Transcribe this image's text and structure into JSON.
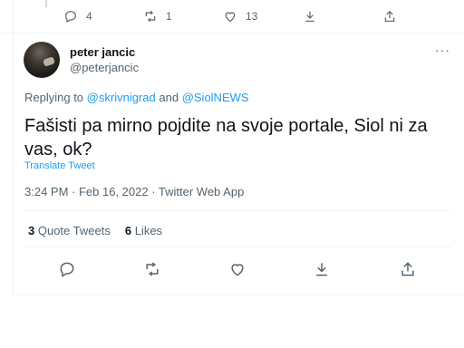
{
  "previous_tweet": {
    "reply_count": "4",
    "retweet_count": "1",
    "like_count": "13"
  },
  "tweet": {
    "author_name": "peter jancic",
    "author_handle": "@peterjancic",
    "more_label": "···",
    "replying_prefix": "Replying to",
    "replying_to_1": "@skrivnigrad",
    "replying_and": "and",
    "replying_to_2": "@SiolNEWS",
    "text": "Fašisti pa mirno pojdite na svoje portale, Siol ni za vas, ok?",
    "translate_label": "Translate Tweet",
    "timestamp": "3:24 PM · Feb 16, 2022 · Twitter Web App",
    "quote_tweets_count": "3",
    "quote_tweets_label": "Quote Tweets",
    "likes_count": "6",
    "likes_label": "Likes"
  },
  "icons": [
    "reply-icon",
    "retweet-icon",
    "like-icon",
    "bookmark-icon",
    "share-icon"
  ],
  "colors": {
    "accent": "#1d9bf0",
    "muted": "#536471",
    "text": "#0f1419",
    "divider": "#eff3f4"
  }
}
